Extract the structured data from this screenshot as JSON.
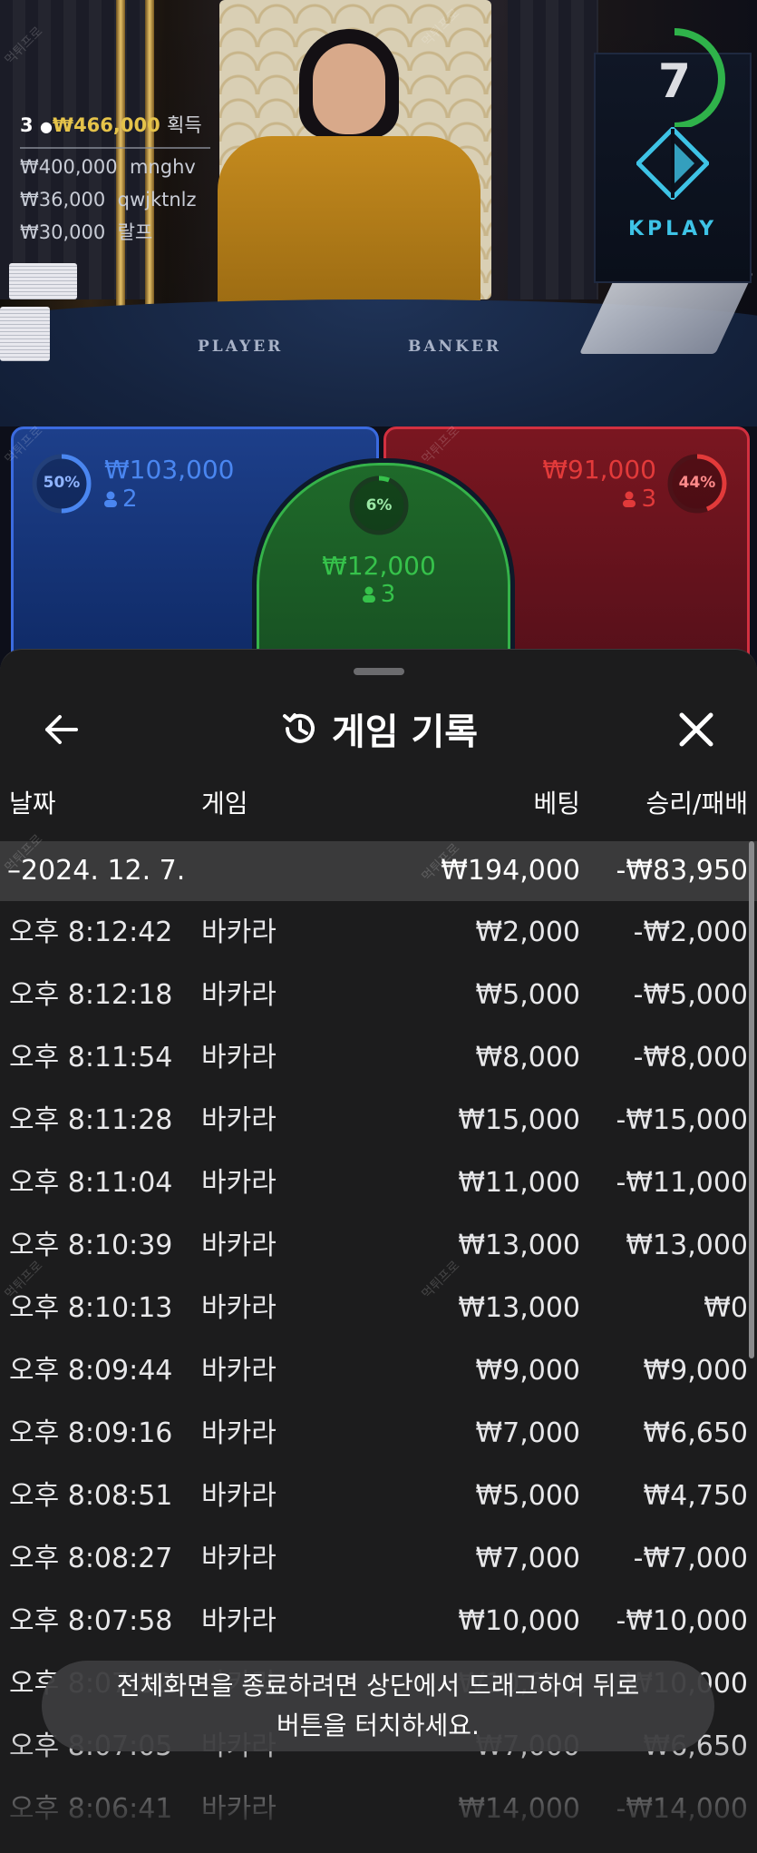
{
  "live": {
    "winners_count": "3",
    "winners_total": "₩466,000",
    "winners_suffix": "획득",
    "winners": [
      {
        "amount": "₩400,000",
        "name": "mnghv"
      },
      {
        "amount": "₩36,000",
        "name": "qwjktnlz"
      },
      {
        "amount": "₩30,000",
        "name": "랄프"
      }
    ],
    "felt_player": "PLAYER",
    "felt_banker": "BANKER",
    "countdown": "7",
    "brand": "KPLAY"
  },
  "bets": {
    "player": {
      "percent": "50%",
      "percent_value": 0.5,
      "total": "₩103,000",
      "users": "2",
      "color": "#4a86f0"
    },
    "tie": {
      "percent": "6%",
      "percent_value": 0.06,
      "total": "₩12,000",
      "users": "3",
      "color": "#36c24b"
    },
    "banker": {
      "percent": "44%",
      "percent_value": 0.44,
      "total": "₩91,000",
      "users": "3",
      "color": "#e23a3a"
    }
  },
  "sheet": {
    "title": "게임 기록",
    "back_icon": "arrow-left-icon",
    "close_icon": "close-icon",
    "history_icon": "history-icon",
    "columns": {
      "date": "날짜",
      "game": "게임",
      "bet": "베팅",
      "result": "승리/패배"
    },
    "date_group": {
      "date": "–2024. 12. 7.",
      "bet": "₩194,000",
      "result": "-₩83,950"
    },
    "rows": [
      {
        "time": "오후 8:12:42",
        "game": "바카라",
        "bet": "₩2,000",
        "result": "-₩2,000"
      },
      {
        "time": "오후 8:12:18",
        "game": "바카라",
        "bet": "₩5,000",
        "result": "-₩5,000"
      },
      {
        "time": "오후 8:11:54",
        "game": "바카라",
        "bet": "₩8,000",
        "result": "-₩8,000"
      },
      {
        "time": "오후 8:11:28",
        "game": "바카라",
        "bet": "₩15,000",
        "result": "-₩15,000"
      },
      {
        "time": "오후 8:11:04",
        "game": "바카라",
        "bet": "₩11,000",
        "result": "-₩11,000"
      },
      {
        "time": "오후 8:10:39",
        "game": "바카라",
        "bet": "₩13,000",
        "result": "₩13,000"
      },
      {
        "time": "오후 8:10:13",
        "game": "바카라",
        "bet": "₩13,000",
        "result": "₩0"
      },
      {
        "time": "오후 8:09:44",
        "game": "바카라",
        "bet": "₩9,000",
        "result": "₩9,000"
      },
      {
        "time": "오후 8:09:16",
        "game": "바카라",
        "bet": "₩7,000",
        "result": "₩6,650"
      },
      {
        "time": "오후 8:08:51",
        "game": "바카라",
        "bet": "₩5,000",
        "result": "₩4,750"
      },
      {
        "time": "오후 8:08:27",
        "game": "바카라",
        "bet": "₩7,000",
        "result": "-₩7,000"
      },
      {
        "time": "오후 8:07:58",
        "game": "바카라",
        "bet": "₩10,000",
        "result": "-₩10,000"
      },
      {
        "time": "오후 8:07:32",
        "game": "바카라",
        "bet": "₩10,000",
        "result": "₩10,000"
      },
      {
        "time": "오후 8:07:05",
        "game": "바카라",
        "bet": "₩7,000",
        "result": "₩6,650"
      },
      {
        "time": "오후 8:06:41",
        "game": "바카라",
        "bet": "₩14,000",
        "result": "-₩14,000"
      }
    ]
  },
  "toast": {
    "line1": "전체화면을 종료하려면 상단에서 드래그하여 뒤로",
    "line2": "버튼을 터치하세요."
  },
  "watermark": "먹튀프로"
}
